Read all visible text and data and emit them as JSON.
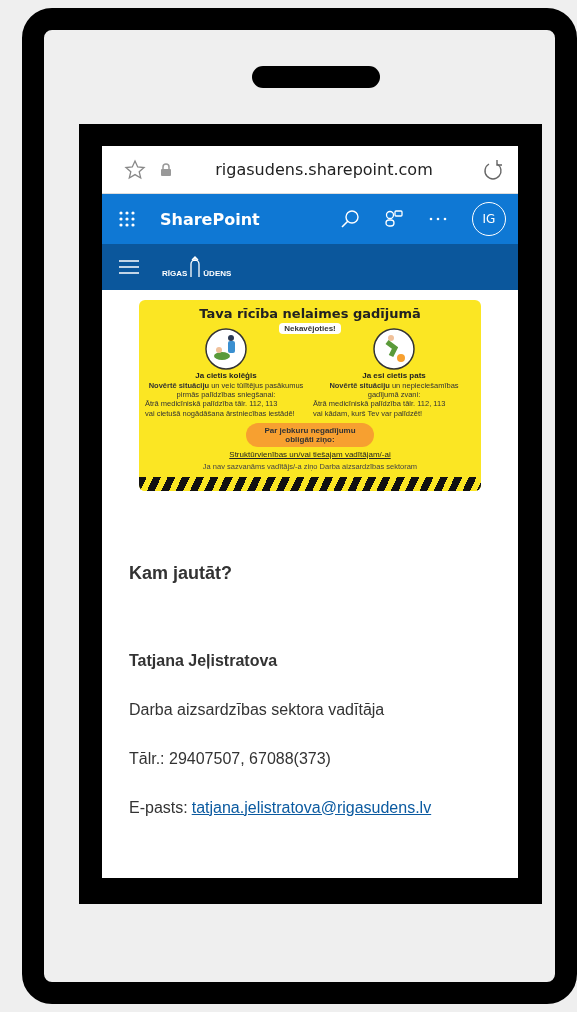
{
  "browser": {
    "url": "rigasudens.sharepoint.com"
  },
  "suite_bar": {
    "app_name": "SharePoint",
    "avatar_initials": "IG"
  },
  "site_bar": {
    "logo_left": "RĪGAS",
    "logo_right": "ŪDENS"
  },
  "poster": {
    "title": "Tava rīcība nelaimes gadījumā",
    "badge": "Nekavējoties!",
    "columns": [
      {
        "heading": "Ja cietis kolēģis",
        "text": "**Novērtē situāciju** un veic tūlītējus pasākumus pirmās palīdzības sniegšanai:",
        "bullets": [
          "Ātrā medicīniskā palīdzība tālr. 112, 113",
          "vai cietušā nogādāšana ārstniecības iestādē!"
        ]
      },
      {
        "heading": "Ja esi cietis pats",
        "text": "**Novērtē situāciju** un nepieciešamības gadījumā zvani:",
        "bullets": [
          "Ātrā medicīniskā palīdzība tālr. 112, 113",
          "vai kādam, kurš Tev var palīdzēt!"
        ]
      }
    ],
    "pill": "Par jebkuru negadījumu obligāti ziņo:",
    "target": "Struktūrvienības un/vai tiešajam vadītājam/-ai",
    "note": "Ja nav sazvanāms vadītājs/-a ziņo Darba aizsardzības sektoram"
  },
  "contact": {
    "heading": "Kam jautāt?",
    "name": "Tatjana Jeļistratova",
    "role": "Darba aizsardzības sektora vadītāja",
    "phone": "Tālr.: 29407507, 67088(373)",
    "email_label": "E-pasts:",
    "email": "tatjana.jelistratova@rigasudens.lv"
  }
}
